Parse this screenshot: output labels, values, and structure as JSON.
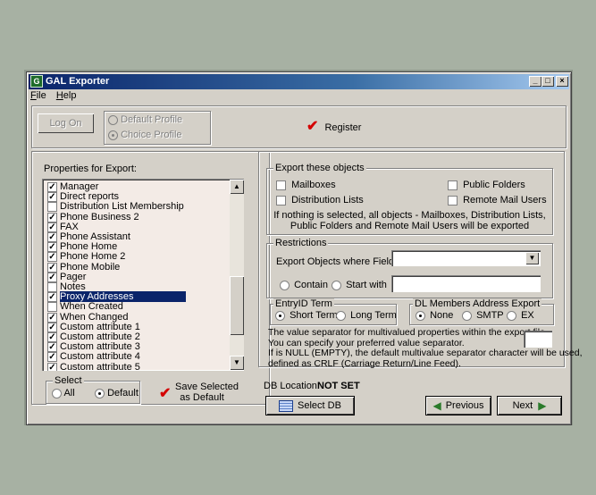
{
  "window": {
    "title": "GAL Exporter"
  },
  "menu": {
    "file": "File",
    "help": "Help"
  },
  "logon": {
    "button": "Log On",
    "default_profile": "Default Profile",
    "choice_profile": "Choice Profile",
    "selected_profile": "Choice Profile"
  },
  "register": {
    "label": "Register"
  },
  "properties": {
    "label": "Properties for Export:",
    "items": [
      {
        "label": "Manager",
        "checked": true
      },
      {
        "label": "Direct reports",
        "checked": true
      },
      {
        "label": "Distribution List Membership",
        "checked": false
      },
      {
        "label": "Phone Business 2",
        "checked": true
      },
      {
        "label": "FAX",
        "checked": true
      },
      {
        "label": "Phone Assistant",
        "checked": true
      },
      {
        "label": "Phone Home",
        "checked": true
      },
      {
        "label": "Phone Home 2",
        "checked": true
      },
      {
        "label": "Phone Mobile",
        "checked": true
      },
      {
        "label": "Pager",
        "checked": true
      },
      {
        "label": "Notes",
        "checked": false
      },
      {
        "label": "Proxy Addresses",
        "checked": true,
        "selected": true
      },
      {
        "label": "When Created",
        "checked": false
      },
      {
        "label": "When Changed",
        "checked": true
      },
      {
        "label": "Custom attribute 1",
        "checked": true
      },
      {
        "label": "Custom attribute 2",
        "checked": true
      },
      {
        "label": "Custom attribute 3",
        "checked": true
      },
      {
        "label": "Custom attribute 4",
        "checked": true
      },
      {
        "label": "Custom attribute 5",
        "checked": true
      }
    ]
  },
  "select_group": {
    "label": "Select",
    "all": "All",
    "default": "Default",
    "selected": "Default"
  },
  "save_default": {
    "line1": "Save Selected",
    "line2": "as Default"
  },
  "export_objects": {
    "label": "Export these objects",
    "mailboxes": "Mailboxes",
    "public_folders": "Public Folders",
    "distribution_lists": "Distribution Lists",
    "remote_mail_users": "Remote Mail Users",
    "note_line1": "If nothing  is selected, all objects - Mailboxes, Distribution Lists,",
    "note_line2": "Public Folders and Remote Mail Users will be exported"
  },
  "restrictions": {
    "label": "Restrictions",
    "field_label": "Export Objects where Field:",
    "field_value": "",
    "contain": "Contain",
    "start_with": "Start with",
    "value": ""
  },
  "entryid": {
    "label": "EntryID Term",
    "short": "Short  Term",
    "long": "Long Term",
    "selected": "Short  Term"
  },
  "dl_members": {
    "label": "DL Members Address Export",
    "none": "None",
    "smtp": "SMTP",
    "ex": "EX",
    "selected": "None"
  },
  "separator": {
    "line1": "The value separator for multivalued properties within the export file.",
    "line2": "You can specify your preferred value separator.",
    "line3": "If is NULL (EMPTY), the default multivalue separator character will be used,",
    "line4": "defined as CRLF (Carriage Return/Line Feed).",
    "value": ""
  },
  "db": {
    "label": "DB Location:",
    "value": "NOT SET",
    "select_button": "Select DB"
  },
  "nav": {
    "previous": "Previous",
    "next": "Next"
  }
}
